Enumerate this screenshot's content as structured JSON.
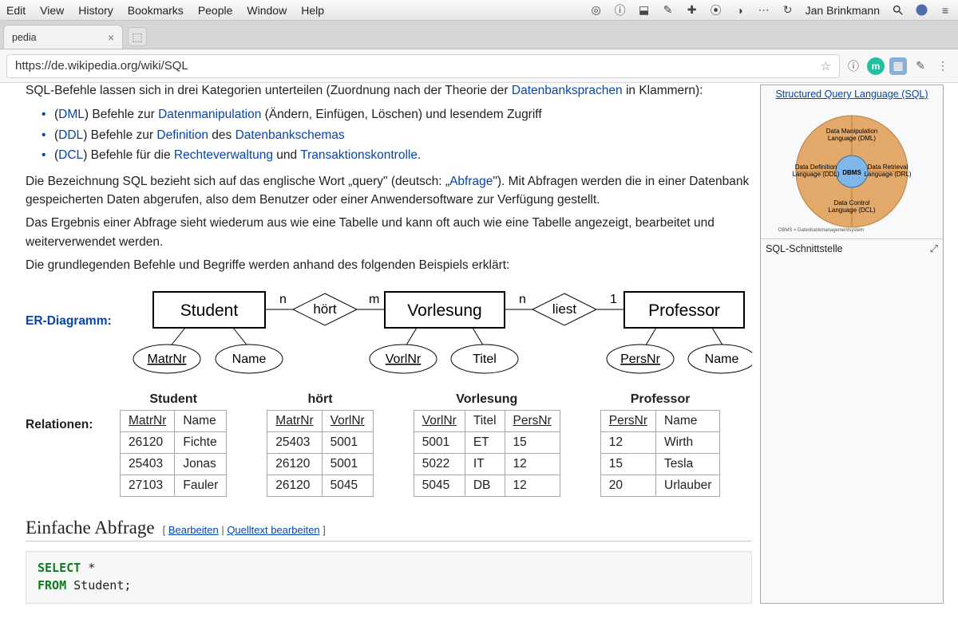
{
  "menubar": {
    "items": [
      "Edit",
      "View",
      "History",
      "Bookmarks",
      "People",
      "Window",
      "Help"
    ],
    "user": "Jan Brinkmann"
  },
  "tab": {
    "title": "pedia"
  },
  "url": "https://de.wikipedia.org/wiki/SQL",
  "article": {
    "intro_cut_prefix": "SQL-Befehle lassen sich in drei Kategorien unterteilen (Zuordnung nach der Theorie der ",
    "intro_cut_link": "Datenbanksprachen",
    "intro_cut_suffix": " in Klammern):",
    "bullets": [
      {
        "abbr": "DML",
        "text1": ") Befehle zur ",
        "link": "Datenmanipulation",
        "text2": " (Ändern, Einfügen, Löschen) und lesendem Zugriff"
      },
      {
        "abbr": "DDL",
        "text1": ") Befehle zur ",
        "link": "Definition",
        "text2": " des ",
        "link2": "Datenbankschemas"
      },
      {
        "abbr": "DCL",
        "text1": ") Befehle für die ",
        "link": "Rechteverwaltung",
        "text2": " und ",
        "link2": "Transaktionskontrolle",
        "text3": "."
      }
    ],
    "para_query_1": "Die Bezeichnung SQL bezieht sich auf das englische Wort „query\" (deutsch: „",
    "para_query_link": "Abfrage",
    "para_query_2": "\"). Mit Abfragen werden die in einer Datenbank gespeicherten Daten abgerufen, also dem Benutzer oder einer Anwendersoftware zur Verfügung gestellt.",
    "para_result": "Das Ergebnis einer Abfrage sieht wiederum aus wie eine Tabelle und kann oft auch wie eine Tabelle angezeigt, bearbeitet und weiterverwendet werden.",
    "para_basic": "Die grundlegenden Befehle und Begriffe werden anhand des folgenden Beispiels erklärt:",
    "er_label": "ER-Diagramm:",
    "rel_label": "Relationen:",
    "er": {
      "entities": [
        "Student",
        "Vorlesung",
        "Professor"
      ],
      "rels": [
        "hört",
        "liest"
      ],
      "cards": [
        "n",
        "m",
        "n",
        "1"
      ],
      "attrs_student": [
        "MatrNr",
        "Name"
      ],
      "attrs_vorlesung": [
        "VorlNr",
        "Titel"
      ],
      "attrs_professor": [
        "PersNr",
        "Name"
      ]
    },
    "tables": {
      "student": {
        "title": "Student",
        "cols": [
          "MatrNr",
          "Name"
        ],
        "pk": [
          true,
          false
        ],
        "rows": [
          [
            "26120",
            "Fichte"
          ],
          [
            "25403",
            "Jonas"
          ],
          [
            "27103",
            "Fauler"
          ]
        ]
      },
      "hoert": {
        "title": "hört",
        "cols": [
          "MatrNr",
          "VorlNr"
        ],
        "pk": [
          true,
          true
        ],
        "rows": [
          [
            "25403",
            "5001"
          ],
          [
            "26120",
            "5001"
          ],
          [
            "26120",
            "5045"
          ]
        ]
      },
      "vorlesung": {
        "title": "Vorlesung",
        "cols": [
          "VorlNr",
          "Titel",
          "PersNr"
        ],
        "pk": [
          true,
          false,
          true
        ],
        "rows": [
          [
            "5001",
            "ET",
            "15"
          ],
          [
            "5022",
            "IT",
            "12"
          ],
          [
            "5045",
            "DB",
            "12"
          ]
        ]
      },
      "professor": {
        "title": "Professor",
        "cols": [
          "PersNr",
          "Name"
        ],
        "pk": [
          true,
          false
        ],
        "rows": [
          [
            "12",
            "Wirth"
          ],
          [
            "15",
            "Tesla"
          ],
          [
            "20",
            "Urlauber"
          ]
        ]
      }
    },
    "section_title": "Einfache Abfrage",
    "edit_links": {
      "open": "[",
      "edit": "Bearbeiten",
      "sep": " | ",
      "src": "Quelltext bearbeiten",
      "close": "]"
    },
    "code": {
      "select": "SELECT",
      "star": " *",
      "from": "FROM",
      "rest": " Student;"
    }
  },
  "infobox": {
    "title": "Structured Query Language (SQL)",
    "caption": "SQL-Schnittstelle",
    "diagram": {
      "center": "DBMS",
      "top": "Data Manipulation Language (DML)",
      "left": "Data Definition Language (DDL)",
      "right": "Data Retrieval Language (DRL)",
      "bottom": "Data Control Language (DCL)",
      "footnote": "DBMS = Datenbankmanagementsystem"
    }
  }
}
